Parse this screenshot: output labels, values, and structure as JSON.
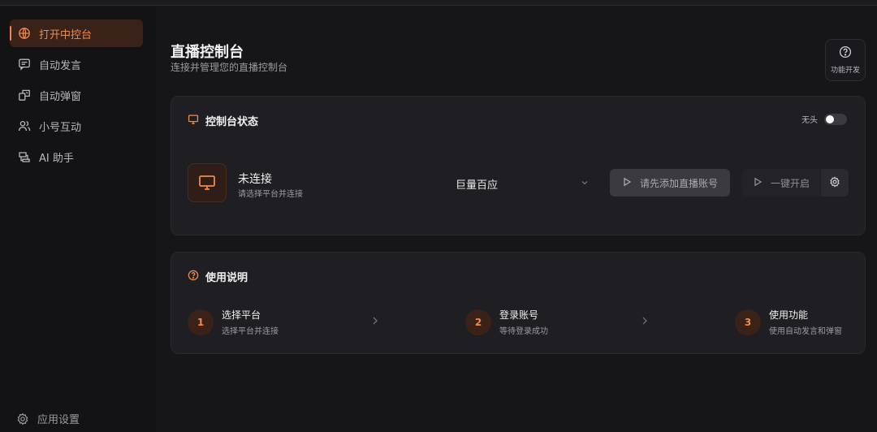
{
  "sidebar": {
    "items": [
      {
        "label": "打开中控台",
        "icon": "globe-icon",
        "active": true
      },
      {
        "label": "自动发言",
        "icon": "message-icon",
        "active": false
      },
      {
        "label": "自动弹窗",
        "icon": "popup-icon",
        "active": false
      },
      {
        "label": "小号互动",
        "icon": "users-icon",
        "active": false
      },
      {
        "label": "AI 助手",
        "icon": "ai-icon",
        "active": false
      }
    ],
    "settings_label": "应用设置"
  },
  "header": {
    "title": "直播控制台",
    "subtitle": "连接并管理您的直播控制台",
    "help_label": "功能开发"
  },
  "status_card": {
    "title": "控制台状态",
    "toggle_label": "无头",
    "toggle_on": false,
    "status_title": "未连接",
    "status_sub": "请选择平台并连接",
    "platform_value": "巨量百应",
    "add_button": "请先添加直播账号",
    "start_button": "一键开启"
  },
  "usage_card": {
    "title": "使用说明",
    "steps": [
      {
        "num": "1",
        "title": "选择平台",
        "desc": "选择平台并连接"
      },
      {
        "num": "2",
        "title": "登录账号",
        "desc": "等待登录成功"
      },
      {
        "num": "3",
        "title": "使用功能",
        "desc": "使用自动发言和弹窗"
      }
    ]
  },
  "colors": {
    "accent": "#f08a4b",
    "background": "#161619",
    "card": "#1f1f23"
  }
}
